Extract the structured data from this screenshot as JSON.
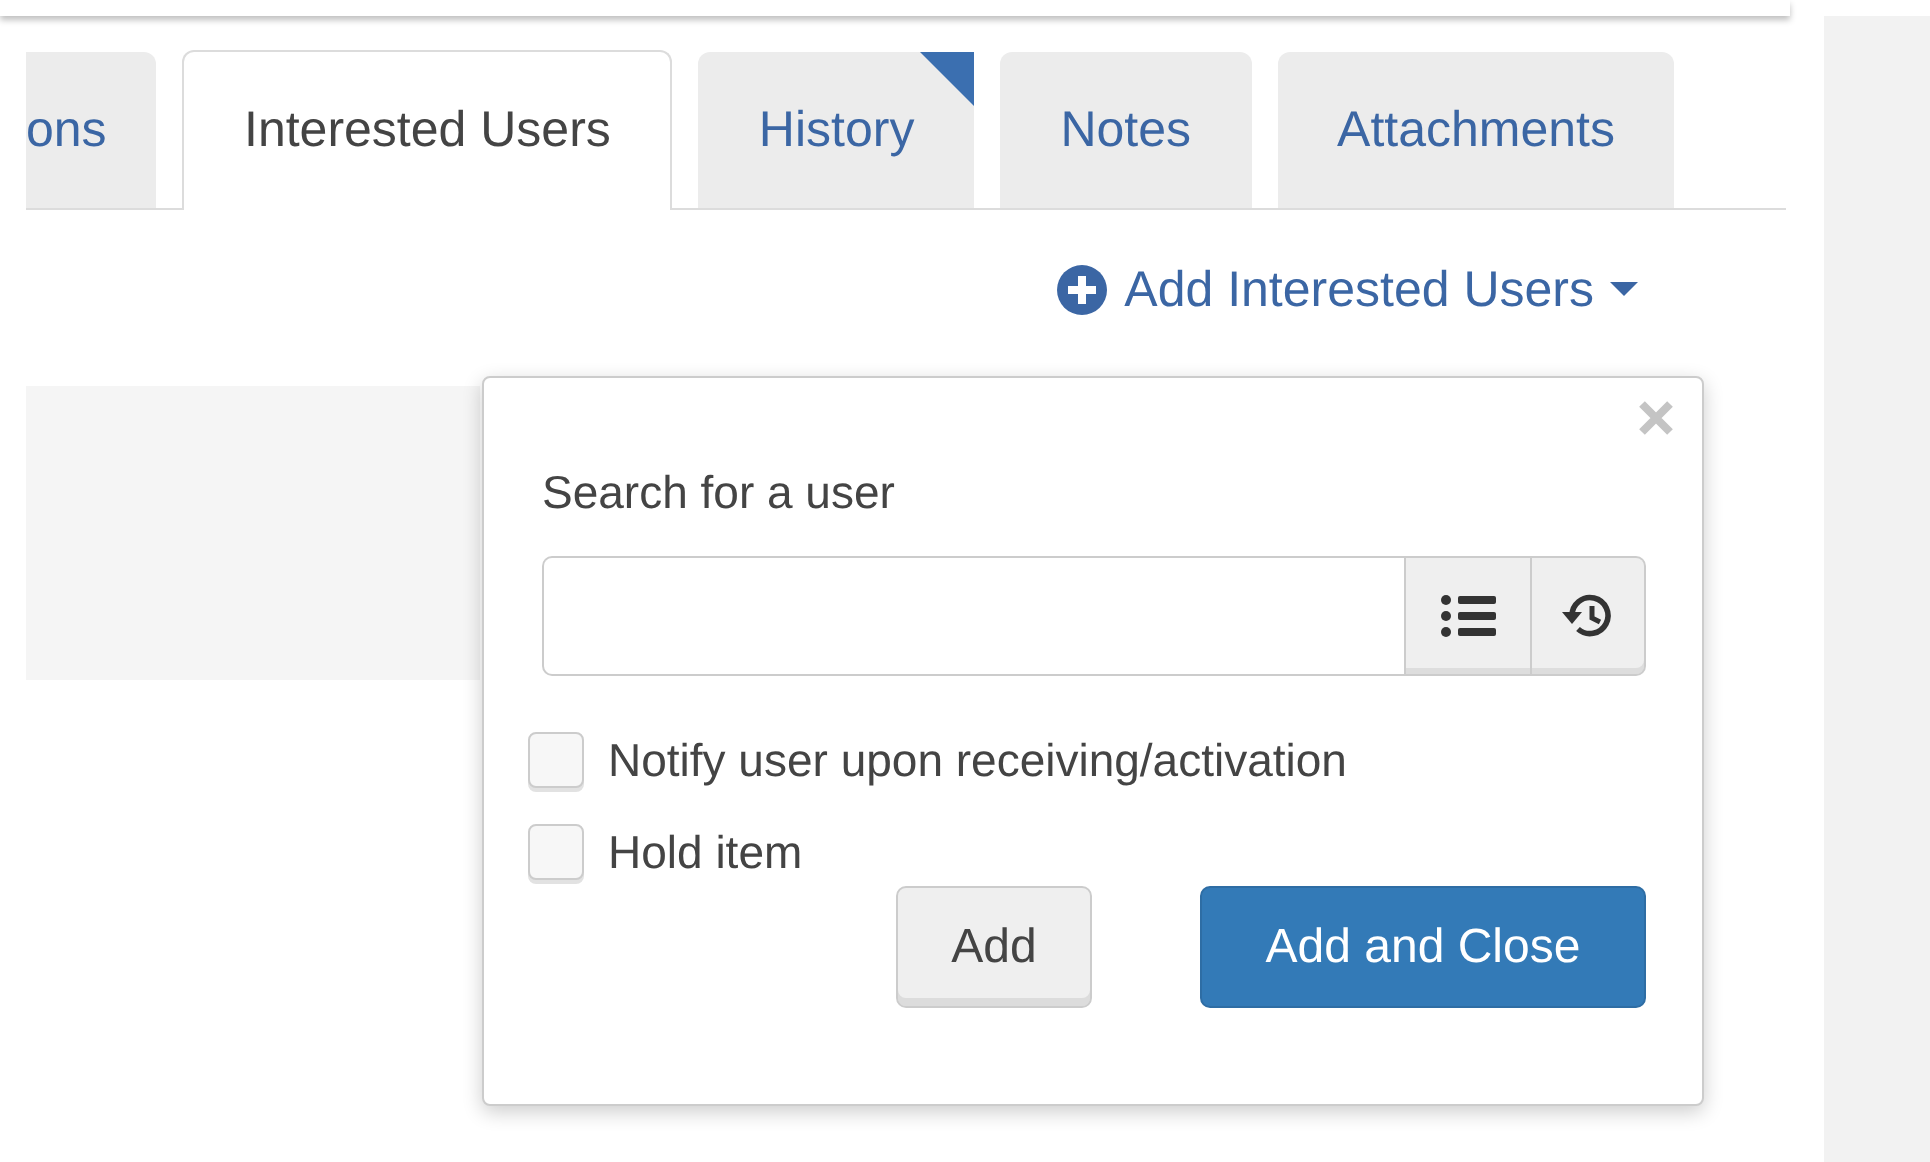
{
  "tabs": [
    {
      "label": "ons",
      "selected": false,
      "flagged": false
    },
    {
      "label": "Interested Users",
      "selected": true,
      "flagged": false
    },
    {
      "label": "History",
      "selected": false,
      "flagged": true
    },
    {
      "label": "Notes",
      "selected": false,
      "flagged": false
    },
    {
      "label": "Attachments",
      "selected": false,
      "flagged": false
    }
  ],
  "add_link": {
    "label": "Add Interested Users"
  },
  "popover": {
    "title": "Search for a user",
    "checkboxes": [
      {
        "label": "Notify user upon receiving/activation",
        "checked": false
      },
      {
        "label": "Hold item",
        "checked": false
      }
    ],
    "buttons": [
      {
        "label": "Add",
        "kind": "default"
      },
      {
        "label": "Add and Close",
        "kind": "primary"
      }
    ]
  }
}
